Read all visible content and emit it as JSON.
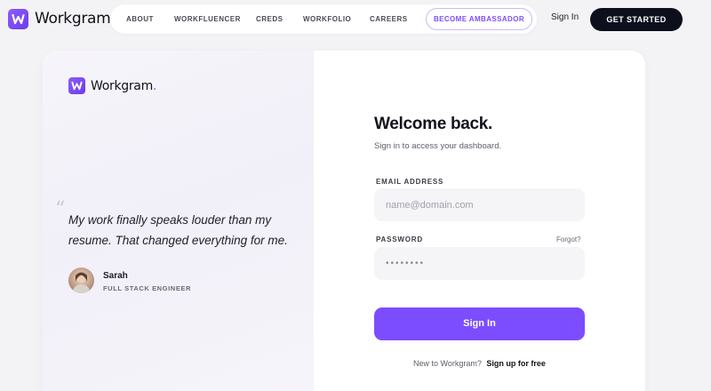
{
  "brand": {
    "name": "Workgram",
    "dot": ".",
    "accent": "#7c4dff"
  },
  "nav": {
    "links": [
      "ABOUT",
      "WORKFLUENCER",
      "CREDS",
      "WORKFOLIO",
      "CAREERS"
    ],
    "ambassador": "BECOME AMBASSADOR",
    "sign_in": "Sign In",
    "get_started": "GET STARTED"
  },
  "testimonial": {
    "quote": "My work finally speaks louder than my resume. That changed everything for me.",
    "quote_mark": "“",
    "author": "Sarah",
    "role": "FULL STACK ENGINEER"
  },
  "form": {
    "title": "Welcome back.",
    "subtitle": "Sign in to access your dashboard.",
    "email_label": "EMAIL ADDRESS",
    "email_placeholder": "name@domain.com",
    "password_label": "PASSWORD",
    "forgot": "Forgot?",
    "password_value": "••••••••",
    "submit": "Sign In",
    "signup_prompt": "New to Workgram?",
    "signup_link": "Sign up for free"
  }
}
